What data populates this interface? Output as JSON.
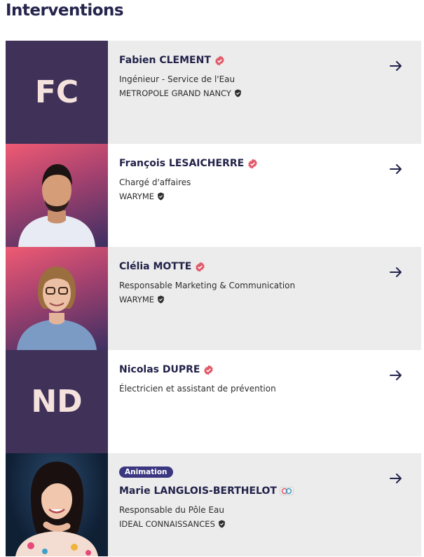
{
  "page": {
    "title": "Interventions"
  },
  "speakers": [
    {
      "initials": "FC",
      "name": "Fabien CLEMENT",
      "role": "Ingénieur - Service de l'Eau",
      "org": "METROPOLE GRAND NANCY"
    },
    {
      "name": "François LESAICHERRE",
      "role": "Chargé d'affaires",
      "org": "WARYME"
    },
    {
      "name": "Clélia MOTTE",
      "role": "Responsable Marketing & Communication",
      "org": "WARYME"
    },
    {
      "initials": "ND",
      "name": "Nicolas DUPRE",
      "role": "Électricien et assistant de prévention"
    },
    {
      "badge": "Animation",
      "name": "Marie LANGLOIS-BERTHELOT",
      "role": "Responsable du Pôle Eau",
      "org": "IDEAL CONNAISSANCES"
    }
  ],
  "colors": {
    "accent": "#e05a6a",
    "navy": "#24244d",
    "avatar_bg": "#3f3158",
    "badge_bg": "#3b3680"
  }
}
